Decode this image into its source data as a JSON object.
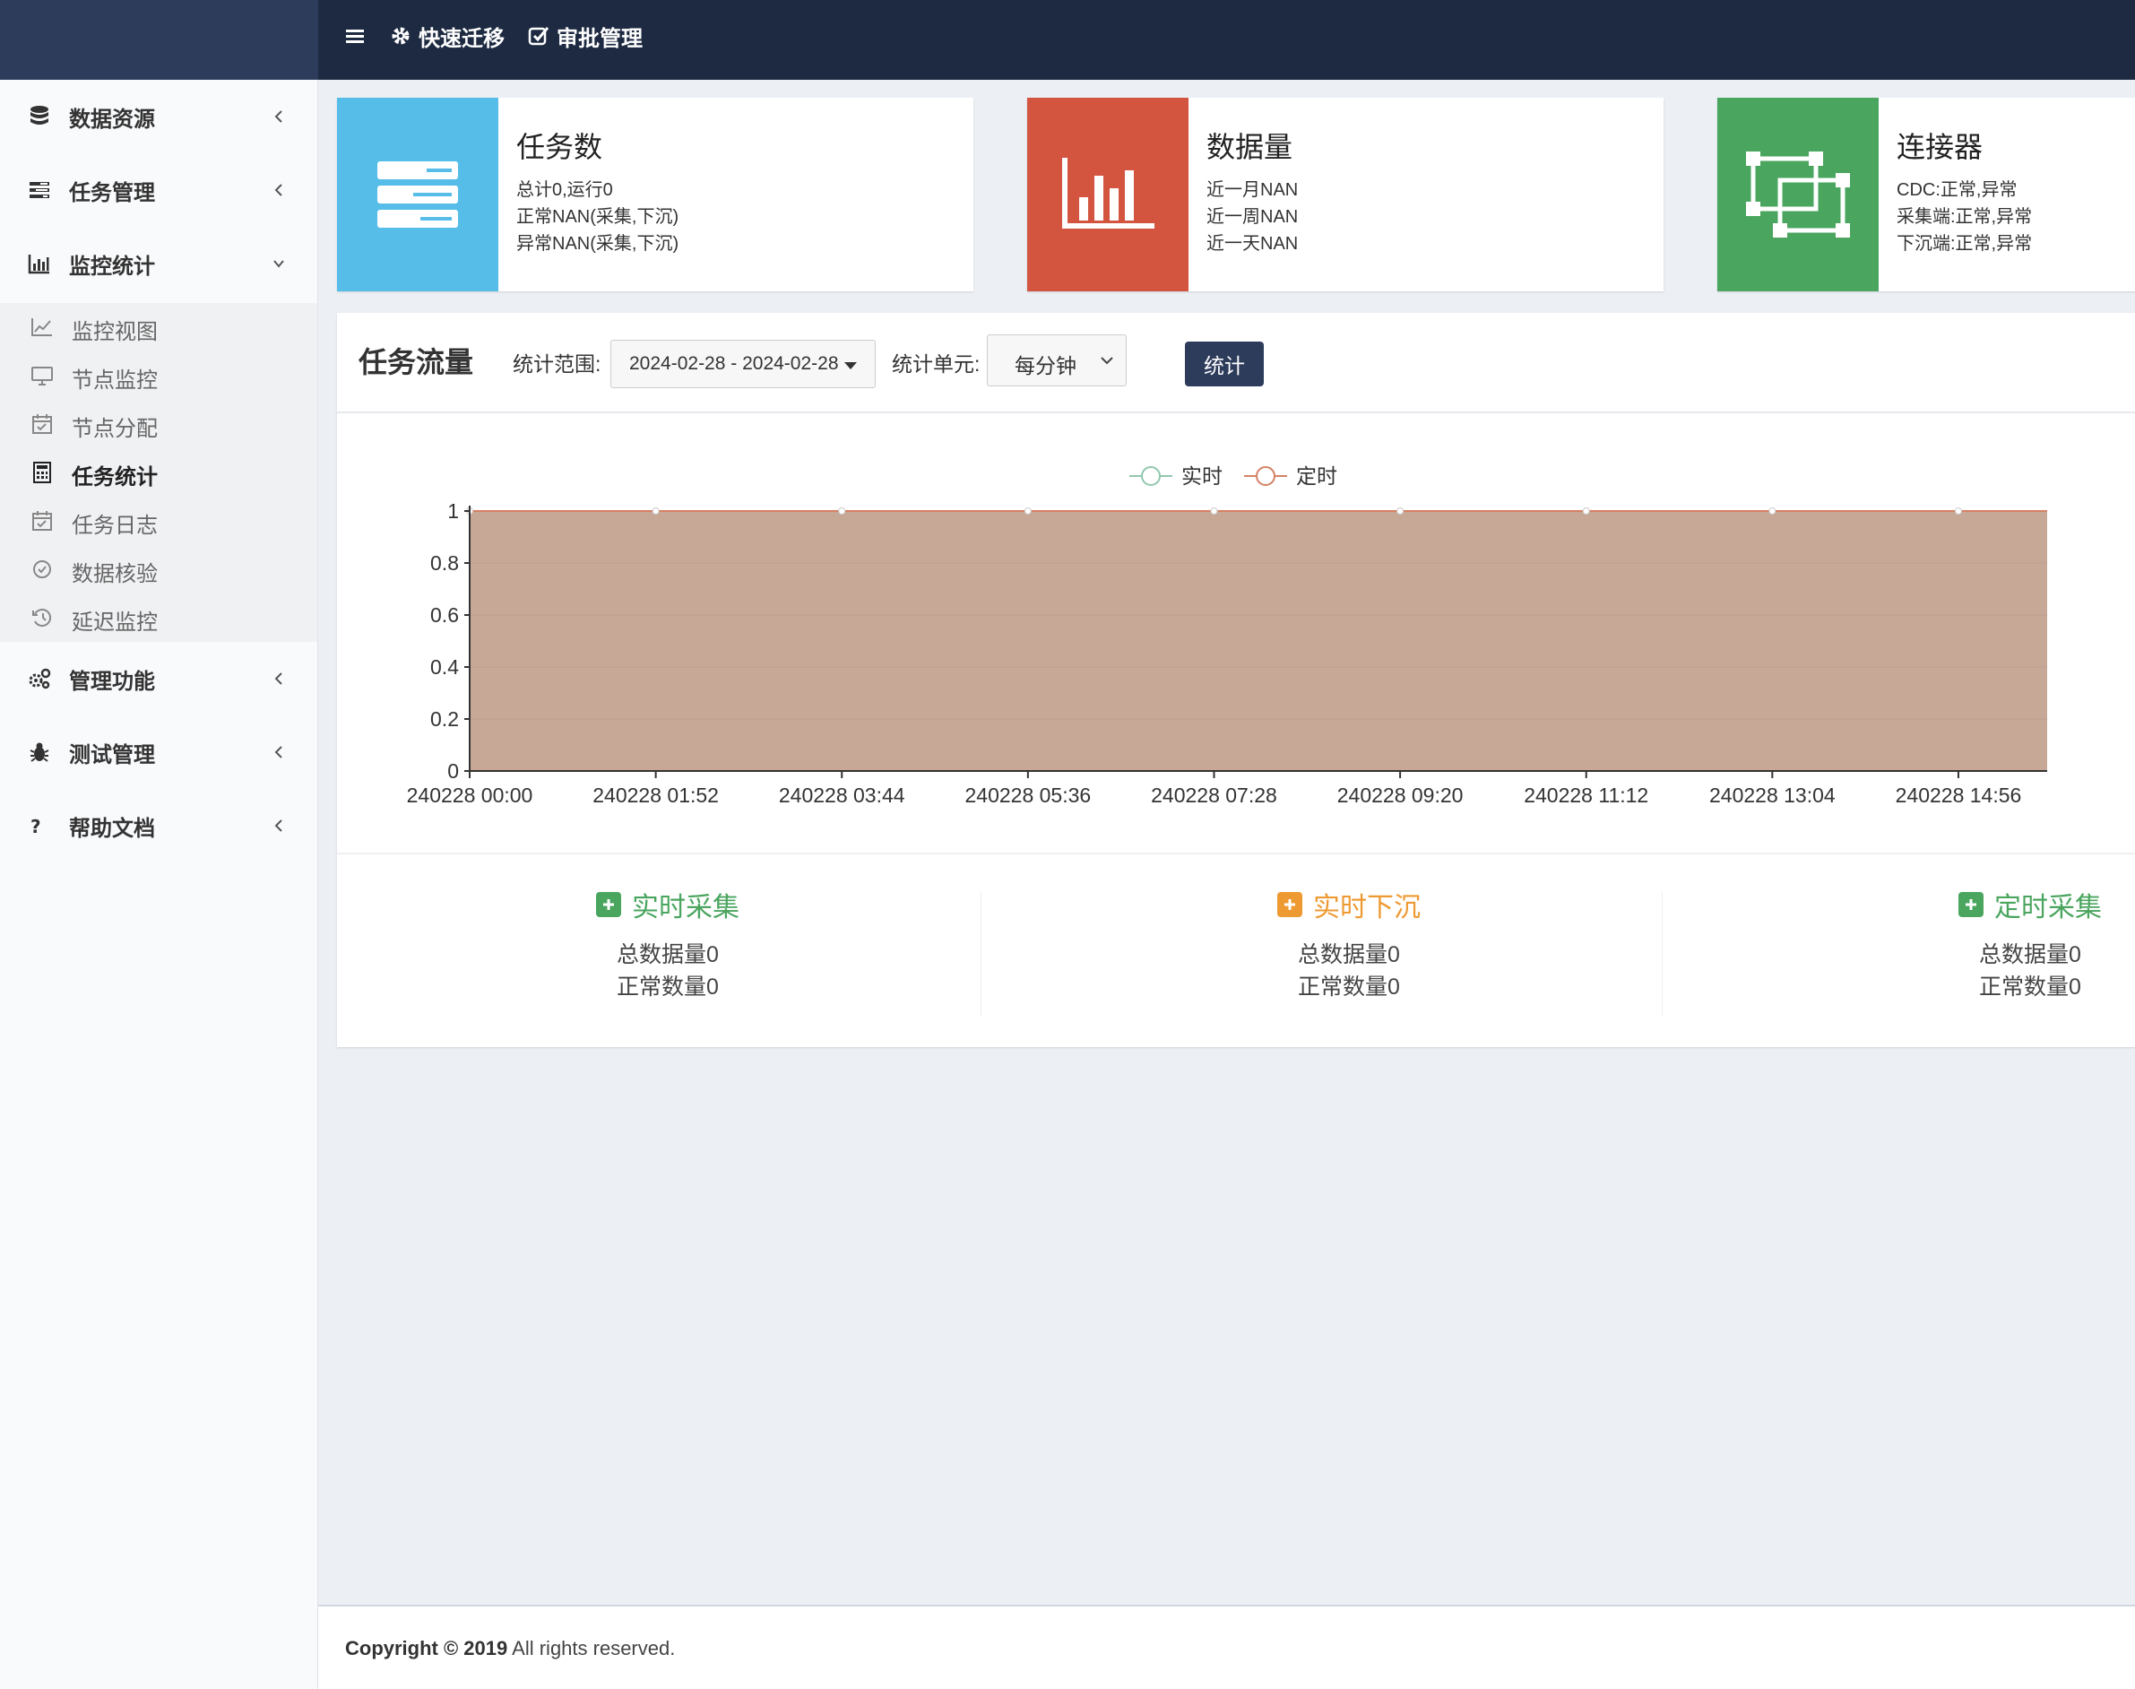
{
  "navbar": {
    "toggle_icon": "hamburger-icon",
    "links": [
      {
        "label": "快速迁移",
        "icon": "gear-icon"
      },
      {
        "label": "审批管理",
        "icon": "check-square-icon"
      }
    ]
  },
  "sidebar": {
    "menu": [
      {
        "label": "数据资源",
        "icon": "database-icon",
        "expanded": false
      },
      {
        "label": "任务管理",
        "icon": "tasks-icon",
        "expanded": false
      },
      {
        "label": "监控统计",
        "icon": "bar-chart-icon",
        "expanded": true
      },
      {
        "label": "管理功能",
        "icon": "cogs-icon",
        "expanded": false
      },
      {
        "label": "测试管理",
        "icon": "bug-icon",
        "expanded": false
      },
      {
        "label": "帮助文档",
        "icon": "question-icon",
        "expanded": false
      }
    ],
    "submenu": [
      {
        "label": "监控视图",
        "icon": "line-chart-icon",
        "active": false
      },
      {
        "label": "节点监控",
        "icon": "desktop-icon",
        "active": false
      },
      {
        "label": "节点分配",
        "icon": "calendar-check-icon",
        "active": false
      },
      {
        "label": "任务统计",
        "icon": "calculator-icon",
        "active": true
      },
      {
        "label": "任务日志",
        "icon": "calendar-check-icon",
        "active": false
      },
      {
        "label": "数据核验",
        "icon": "check-circle-icon",
        "active": false
      },
      {
        "label": "延迟监控",
        "icon": "history-icon",
        "active": false
      }
    ]
  },
  "info_boxes": [
    {
      "title": "任务数",
      "color": "#56bde9",
      "icon": "server-icon",
      "lines": [
        "总计0,运行0",
        "正常NAN(采集,下沉)",
        "异常NAN(采集,下沉)"
      ]
    },
    {
      "title": "数据量",
      "color": "#d35540",
      "icon": "bar-chart-icon",
      "lines": [
        "近一月NAN",
        "近一周NAN",
        "近一天NAN"
      ]
    },
    {
      "title": "连接器",
      "color": "#4aa55f",
      "icon": "object-group-icon",
      "lines": [
        "CDC:正常,异常",
        "采集端:正常,异常",
        "下沉端:正常,异常"
      ]
    }
  ],
  "task_flow": {
    "title": "任务流量",
    "range_label": "统计范围:",
    "range_value": "2024-02-28 - 2024-02-28",
    "unit_label": "统计单元:",
    "unit_value": "每分钟",
    "button_label": "统计"
  },
  "chart_data": {
    "type": "area",
    "series": [
      {
        "name": "实时",
        "color": "#91c7ae",
        "values": [
          1,
          1,
          1,
          1,
          1,
          1,
          1,
          1,
          1
        ]
      },
      {
        "name": "定时",
        "color": "#d48265",
        "values": [
          1,
          1,
          1,
          1,
          1,
          1,
          1,
          1,
          1
        ]
      }
    ],
    "categories": [
      "240228 00:00",
      "240228 01:52",
      "240228 03:44",
      "240228 05:36",
      "240228 07:28",
      "240228 09:20",
      "240228 11:12",
      "240228 13:04",
      "240228 14:56"
    ],
    "y_ticks": [
      "0",
      "0.2",
      "0.4",
      "0.6",
      "0.8",
      "1"
    ],
    "ylim": [
      0,
      1
    ],
    "area_color": "#c7a796",
    "legend_position": "top-center"
  },
  "stats": [
    {
      "title": "实时采集",
      "color": "#4aa55f",
      "total_label": "总数据量",
      "total_value": "0",
      "normal_label": "正常数量",
      "normal_value": "0"
    },
    {
      "title": "实时下沉",
      "color": "#ee9a33",
      "total_label": "总数据量",
      "total_value": "0",
      "normal_label": "正常数量",
      "normal_value": "0"
    },
    {
      "title": "定时采集",
      "color": "#4aa55f",
      "total_label": "总数据量",
      "total_value": "0",
      "normal_label": "正常数量",
      "normal_value": "0"
    }
  ],
  "footer": {
    "copyright_bold": "Copyright © 2019",
    "rights": " All rights reserved."
  }
}
